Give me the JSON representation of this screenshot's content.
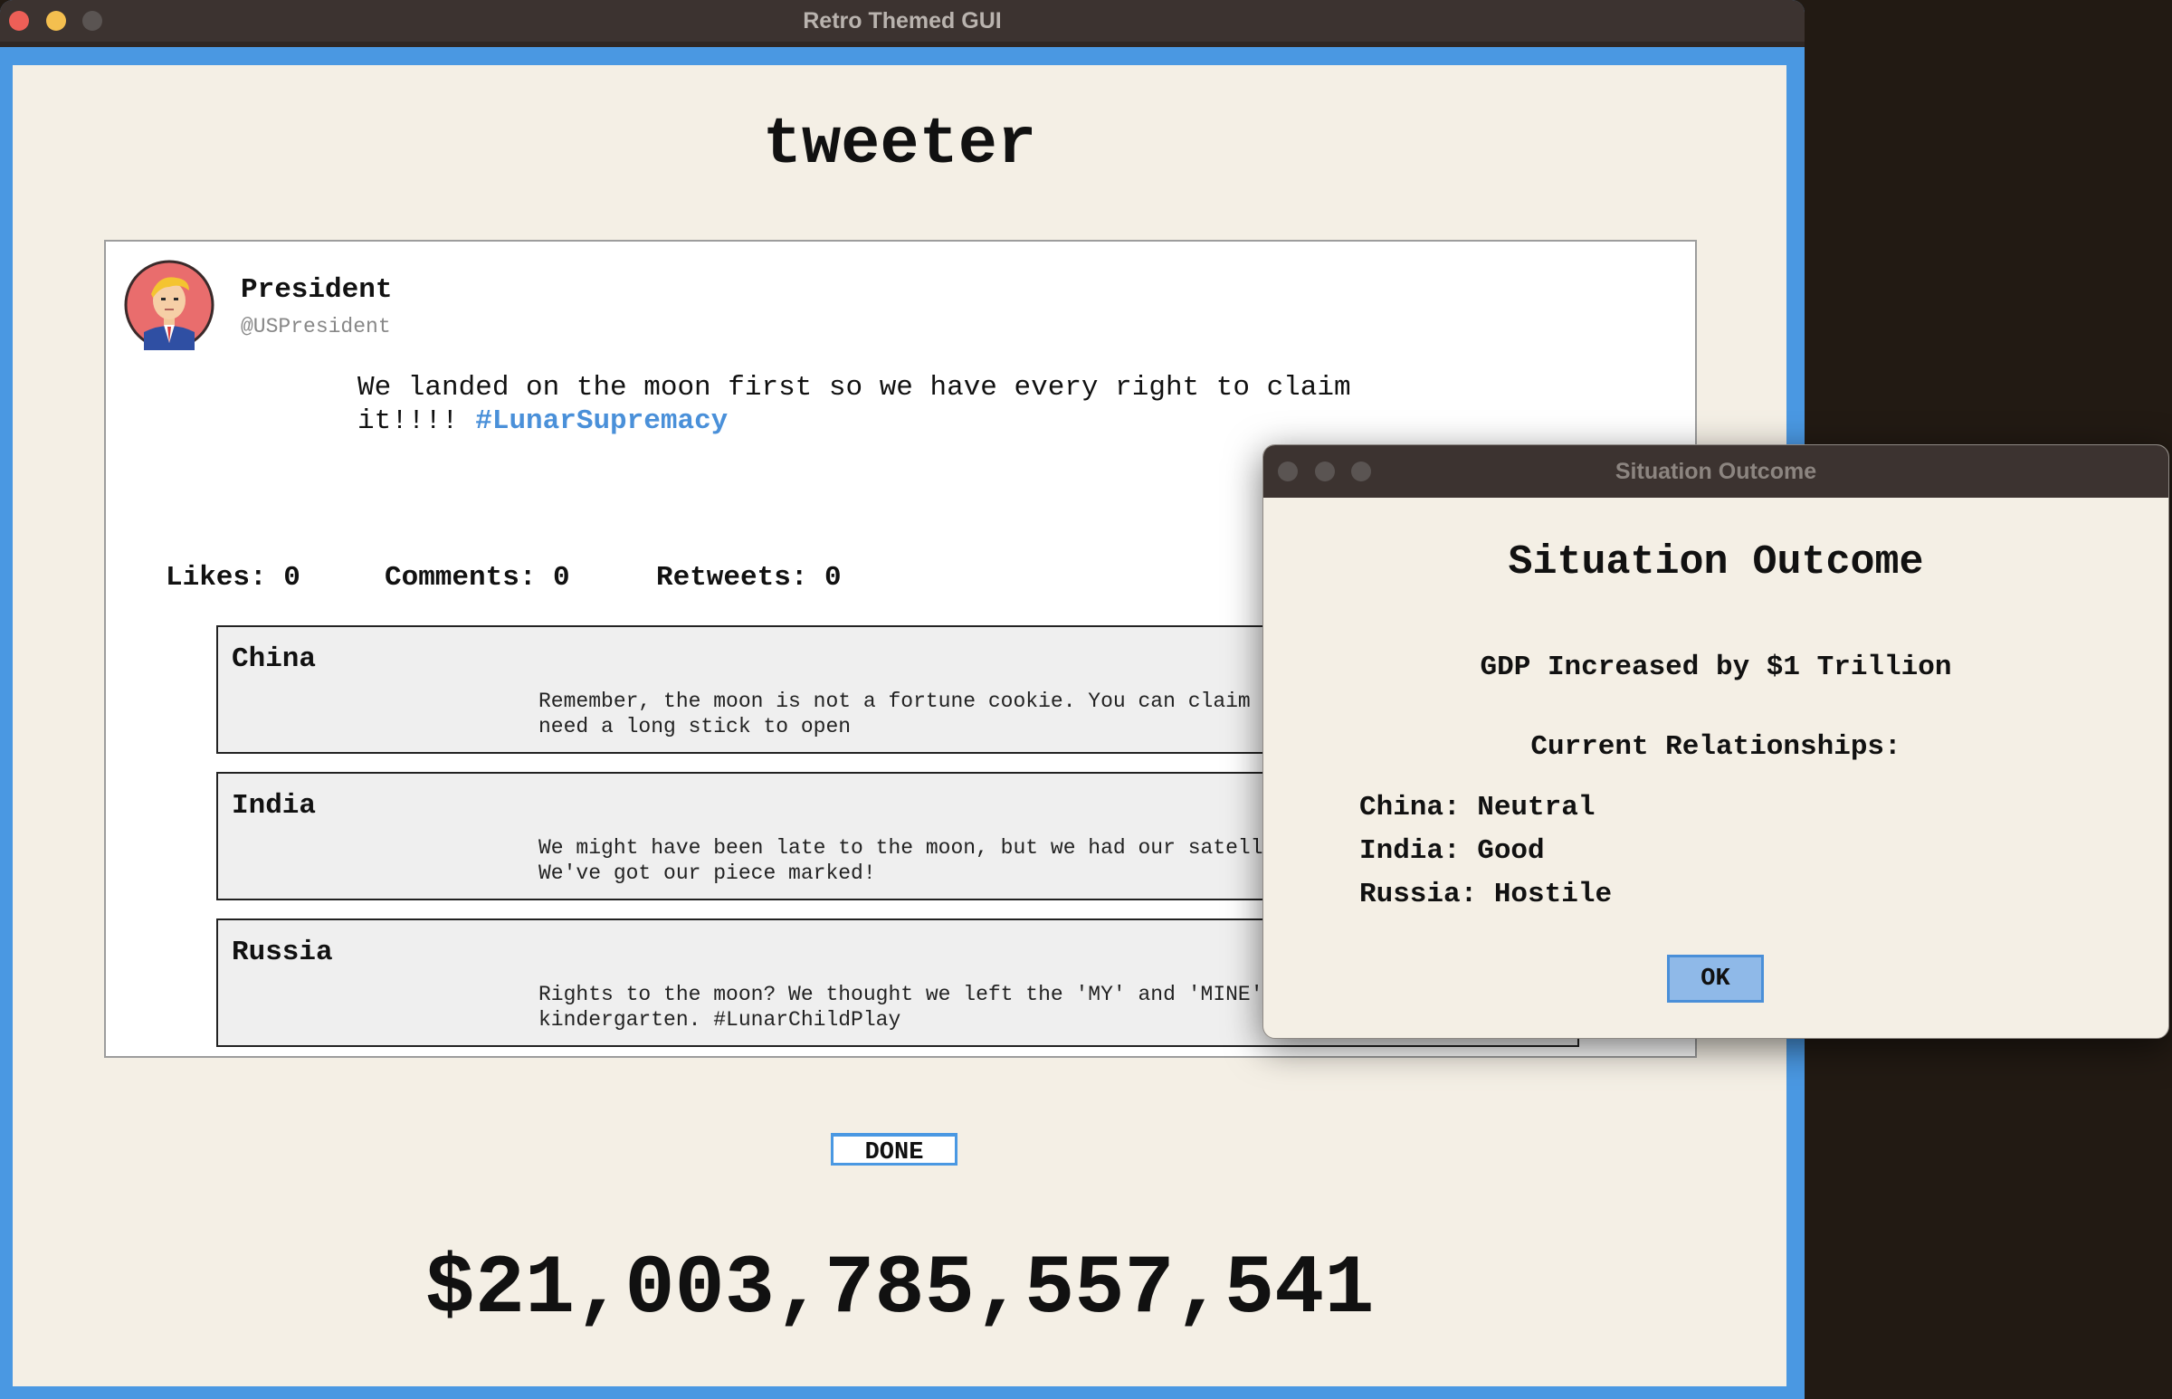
{
  "main_window": {
    "title": "Retro Themed GUI",
    "app_title": "tweeter",
    "tweet": {
      "author_name": "President",
      "author_handle": "@USPresident",
      "text": "We landed on the moon first so we have every right to claim it!!!! ",
      "hashtag": "#LunarSupremacy",
      "stats": {
        "likes": "Likes: 0",
        "comments": "Comments: 0",
        "retweets": "Retweets: 0"
      },
      "replies": [
        {
          "name": "China",
          "text": "Remember, the moon is not a fortune cookie. You can claim all the 'rights', but need a long stick to open"
        },
        {
          "name": "India",
          "text": "We might have been late to the moon, but we had our satellites keeping an eye. We've got our piece marked!"
        },
        {
          "name": "Russia",
          "text": "Rights to the moon? We thought we left the 'MY' and 'MINE' behind in the kindergarten. #LunarChildPlay"
        }
      ]
    },
    "done_label": "DONE",
    "gdp": "$21,003,785,557,541"
  },
  "dialog": {
    "window_title": "Situation Outcome",
    "heading": "Situation Outcome",
    "gdp_message": "GDP Increased by $1 Trillion",
    "relationships_heading": "Current Relationships:",
    "relationships": [
      "China: Neutral",
      "India: Good",
      "Russia: Hostile"
    ],
    "ok_label": "OK"
  },
  "colors": {
    "window_border": "#4a98e2",
    "content_bg": "#f4efe5",
    "hashtag": "#4a90d9",
    "ok_button": "#8fb9e8"
  }
}
